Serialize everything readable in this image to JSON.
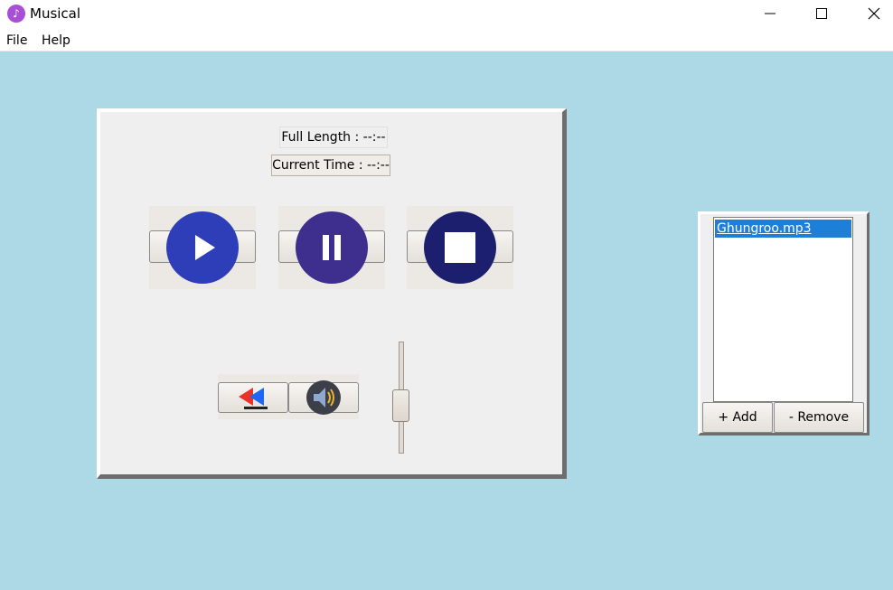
{
  "window": {
    "title": "Musical",
    "controls": {
      "minimize": "—",
      "maximize": "☐",
      "close": "✕"
    }
  },
  "menu": {
    "file": "File",
    "help": "Help"
  },
  "player": {
    "full_length_label": "Full Length : --:--",
    "current_time_label": "Current Time : --:--",
    "play_color": "#2e3eb8",
    "pause_color": "#3e2f8e",
    "stop_color": "#1b1f6e",
    "volume_level": 0.5
  },
  "playlist": {
    "items": [
      "Ghungroo.mp3"
    ],
    "add_label": "+ Add",
    "remove_label": "- Remove"
  }
}
